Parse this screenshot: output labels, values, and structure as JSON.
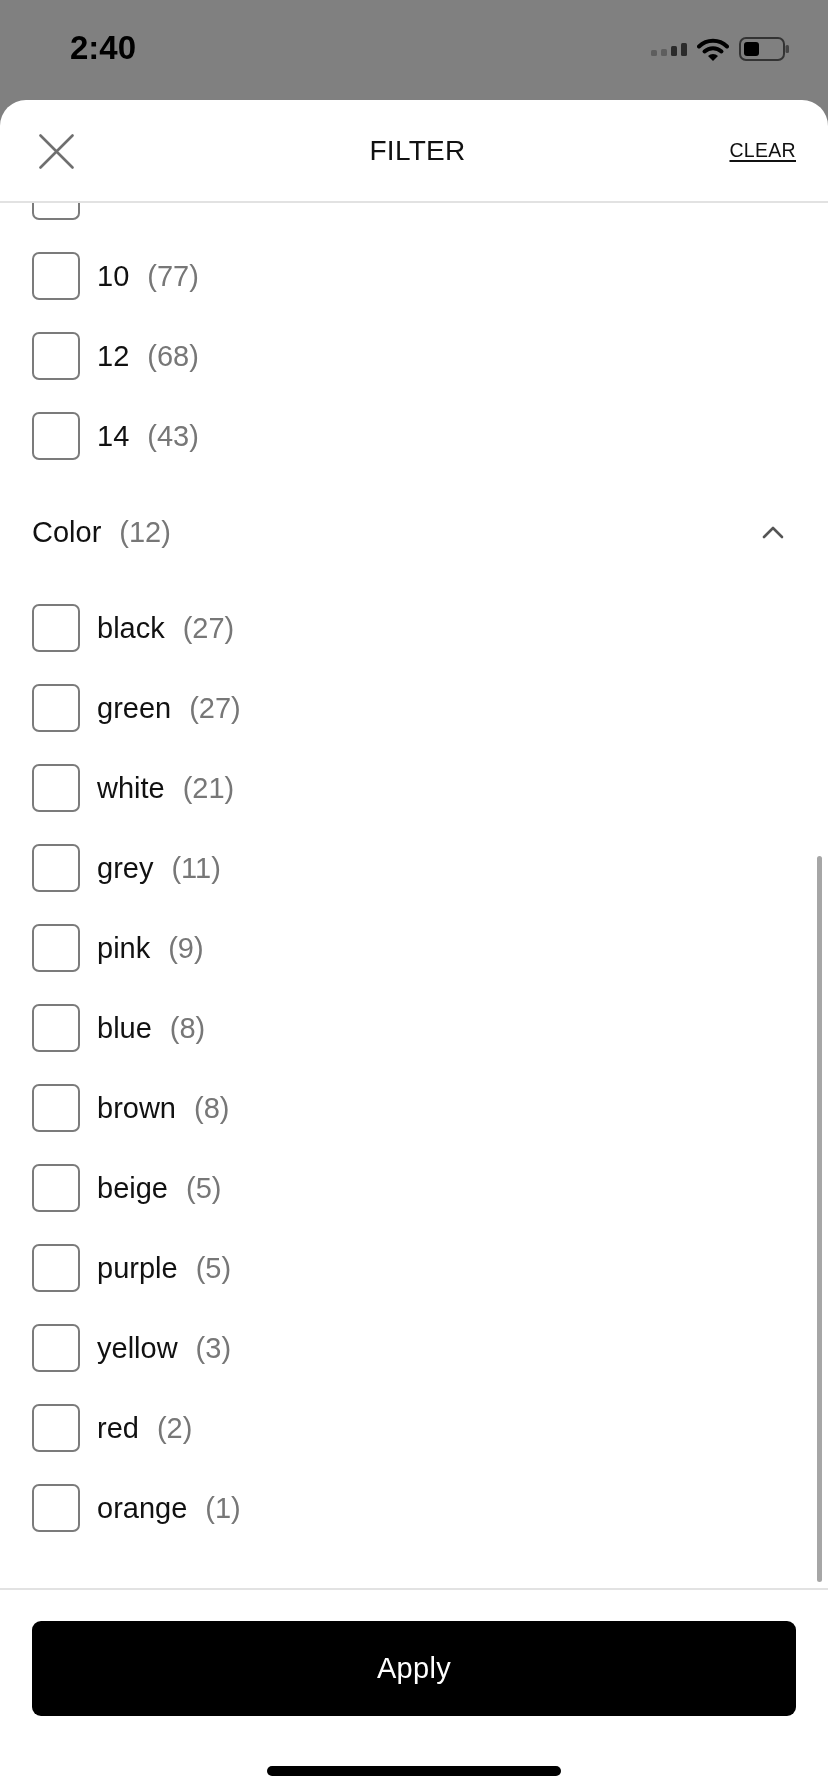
{
  "status_bar": {
    "time": "2:40"
  },
  "header": {
    "title": "FILTER",
    "clear_label": "CLEAR"
  },
  "sections": [
    {
      "kind": "list",
      "options": [
        {
          "checked": false
        },
        {
          "label": "10",
          "count": "(77)",
          "checked": false
        },
        {
          "label": "12",
          "count": "(68)",
          "checked": false
        },
        {
          "label": "14",
          "count": "(43)",
          "checked": false
        }
      ]
    },
    {
      "kind": "group",
      "title": "Color",
      "count": "(12)",
      "expanded": true,
      "options": [
        {
          "label": "black",
          "count": "(27)",
          "checked": false
        },
        {
          "label": "green",
          "count": "(27)",
          "checked": false
        },
        {
          "label": "white",
          "count": "(21)",
          "checked": false
        },
        {
          "label": "grey",
          "count": "(11)",
          "checked": false
        },
        {
          "label": "pink",
          "count": "(9)",
          "checked": false
        },
        {
          "label": "blue",
          "count": "(8)",
          "checked": false
        },
        {
          "label": "brown",
          "count": "(8)",
          "checked": false
        },
        {
          "label": "beige",
          "count": "(5)",
          "checked": false
        },
        {
          "label": "purple",
          "count": "(5)",
          "checked": false
        },
        {
          "label": "yellow",
          "count": "(3)",
          "checked": false
        },
        {
          "label": "red",
          "count": "(2)",
          "checked": false
        },
        {
          "label": "orange",
          "count": "(1)",
          "checked": false
        }
      ]
    }
  ],
  "apply_button": {
    "label": "Apply"
  }
}
